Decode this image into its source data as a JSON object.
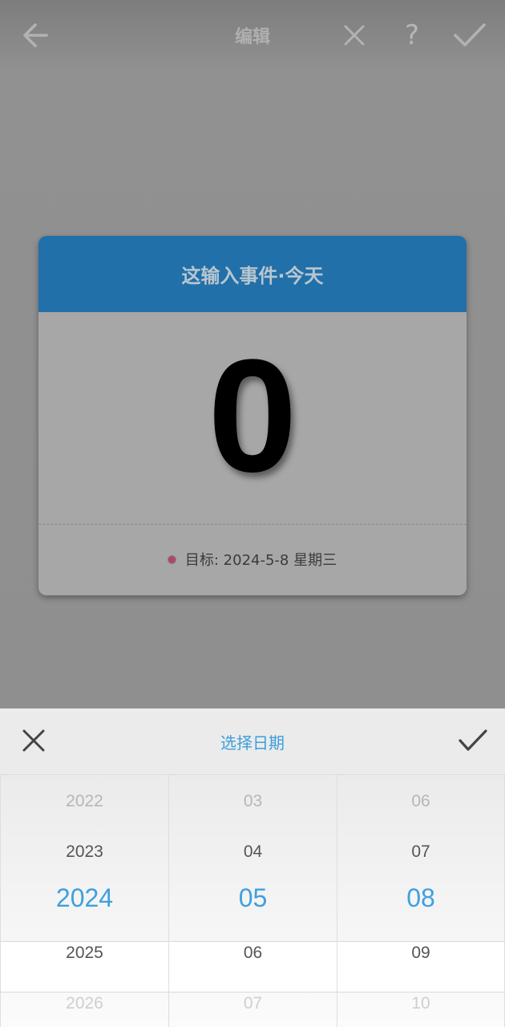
{
  "appbar": {
    "title": "编辑",
    "help_label": "?",
    "icons": [
      "arrow-left-icon",
      "close-icon",
      "help-icon",
      "check-icon"
    ]
  },
  "card": {
    "header": "这输入事件·今天",
    "value": "0",
    "target": "目标: 2024-5-8 星期三",
    "colors": {
      "header_bg": "#2170a9",
      "dot": "#b0446e"
    }
  },
  "picker": {
    "title": "选择日期",
    "icons": [
      "close-icon",
      "check-icon"
    ],
    "accent": "#3ea0df",
    "columns": [
      {
        "name": "year",
        "items": [
          "2022",
          "2023",
          "2024",
          "2025",
          "2026"
        ],
        "selected": "2024"
      },
      {
        "name": "month",
        "items": [
          "03",
          "04",
          "05",
          "06",
          "07"
        ],
        "selected": "05"
      },
      {
        "name": "day",
        "items": [
          "06",
          "07",
          "08",
          "09",
          "10"
        ],
        "selected": "08"
      }
    ]
  }
}
